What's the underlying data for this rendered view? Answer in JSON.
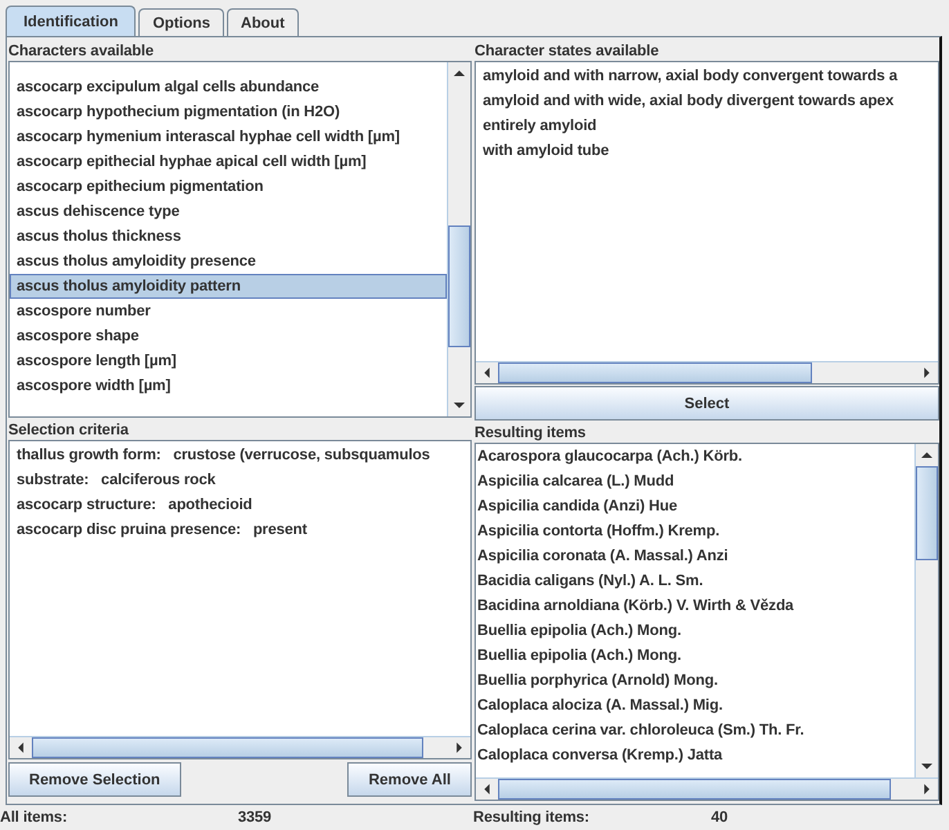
{
  "tabs": [
    {
      "label": "Identification",
      "selected": true
    },
    {
      "label": "Options",
      "selected": false
    },
    {
      "label": "About",
      "selected": false
    }
  ],
  "characters": {
    "label": "Characters available",
    "items": [
      {
        "text": "ascocarp excipulum algal cells abundance",
        "selected": false
      },
      {
        "text": "ascocarp hypothecium pigmentation (in H2O)",
        "selected": false
      },
      {
        "text": "ascocarp hymenium interascal hyphae cell width [µm]",
        "selected": false
      },
      {
        "text": "ascocarp epithecial hyphae apical cell width [µm]",
        "selected": false
      },
      {
        "text": "ascocarp epithecium pigmentation",
        "selected": false
      },
      {
        "text": "ascus dehiscence type",
        "selected": false
      },
      {
        "text": "ascus tholus thickness",
        "selected": false
      },
      {
        "text": "ascus tholus amyloidity presence",
        "selected": false
      },
      {
        "text": "ascus tholus amyloidity pattern",
        "selected": true
      },
      {
        "text": "ascospore number",
        "selected": false
      },
      {
        "text": "ascospore shape",
        "selected": false
      },
      {
        "text": "ascospore length [µm]",
        "selected": false
      },
      {
        "text": "ascospore width [µm]",
        "selected": false
      }
    ]
  },
  "states": {
    "label": "Character states available",
    "items": [
      "amyloid and with narrow, axial body convergent towards a",
      "amyloid and with wide, axial body divergent towards apex",
      "entirely amyloid",
      "with amyloid tube"
    ],
    "button": "Select"
  },
  "criteria": {
    "label": "Selection criteria",
    "items": [
      "thallus growth form:   crustose (verrucose, subsquamulos",
      "substrate:   calciferous rock",
      "ascocarp structure:   apothecioid",
      "ascocarp disc pruina presence:   present"
    ],
    "buttons": [
      "Remove Selection",
      "Remove All"
    ]
  },
  "results": {
    "label": "Resulting  items",
    "items": [
      "Acarospora glaucocarpa (Ach.) Körb.",
      "Aspicilia calcarea (L.) Mudd",
      "Aspicilia candida (Anzi) Hue",
      "Aspicilia contorta (Hoffm.) Kremp.",
      "Aspicilia coronata (A. Massal.) Anzi",
      "Bacidia caligans (Nyl.) A. L. Sm.",
      "Bacidina arnoldiana (Körb.) V. Wirth & Vězda",
      "Buellia epipolia (Ach.) Mong.",
      "Buellia epipolia (Ach.) Mong.",
      "Buellia porphyrica (Arnold) Mong.",
      "Caloplaca alociza (A. Massal.) Mig.",
      "Caloplaca cerina var. chloroleuca (Sm.) Th. Fr.",
      "Caloplaca conversa (Kremp.) Jatta"
    ]
  },
  "status": [
    {
      "label": "All items:",
      "value": "3359"
    },
    {
      "label": "Resulting items:",
      "value": "40"
    }
  ]
}
